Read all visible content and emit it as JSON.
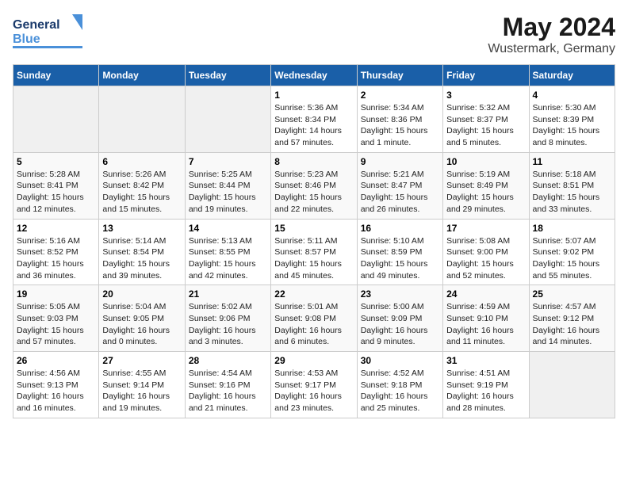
{
  "header": {
    "logo_general": "General",
    "logo_blue": "Blue",
    "title": "May 2024",
    "subtitle": "Wustermark, Germany"
  },
  "weekdays": [
    "Sunday",
    "Monday",
    "Tuesday",
    "Wednesday",
    "Thursday",
    "Friday",
    "Saturday"
  ],
  "weeks": [
    [
      {
        "day": "",
        "sunrise": "",
        "sunset": "",
        "daylight": ""
      },
      {
        "day": "",
        "sunrise": "",
        "sunset": "",
        "daylight": ""
      },
      {
        "day": "",
        "sunrise": "",
        "sunset": "",
        "daylight": ""
      },
      {
        "day": "1",
        "sunrise": "Sunrise: 5:36 AM",
        "sunset": "Sunset: 8:34 PM",
        "daylight": "Daylight: 14 hours and 57 minutes."
      },
      {
        "day": "2",
        "sunrise": "Sunrise: 5:34 AM",
        "sunset": "Sunset: 8:36 PM",
        "daylight": "Daylight: 15 hours and 1 minute."
      },
      {
        "day": "3",
        "sunrise": "Sunrise: 5:32 AM",
        "sunset": "Sunset: 8:37 PM",
        "daylight": "Daylight: 15 hours and 5 minutes."
      },
      {
        "day": "4",
        "sunrise": "Sunrise: 5:30 AM",
        "sunset": "Sunset: 8:39 PM",
        "daylight": "Daylight: 15 hours and 8 minutes."
      }
    ],
    [
      {
        "day": "5",
        "sunrise": "Sunrise: 5:28 AM",
        "sunset": "Sunset: 8:41 PM",
        "daylight": "Daylight: 15 hours and 12 minutes."
      },
      {
        "day": "6",
        "sunrise": "Sunrise: 5:26 AM",
        "sunset": "Sunset: 8:42 PM",
        "daylight": "Daylight: 15 hours and 15 minutes."
      },
      {
        "day": "7",
        "sunrise": "Sunrise: 5:25 AM",
        "sunset": "Sunset: 8:44 PM",
        "daylight": "Daylight: 15 hours and 19 minutes."
      },
      {
        "day": "8",
        "sunrise": "Sunrise: 5:23 AM",
        "sunset": "Sunset: 8:46 PM",
        "daylight": "Daylight: 15 hours and 22 minutes."
      },
      {
        "day": "9",
        "sunrise": "Sunrise: 5:21 AM",
        "sunset": "Sunset: 8:47 PM",
        "daylight": "Daylight: 15 hours and 26 minutes."
      },
      {
        "day": "10",
        "sunrise": "Sunrise: 5:19 AM",
        "sunset": "Sunset: 8:49 PM",
        "daylight": "Daylight: 15 hours and 29 minutes."
      },
      {
        "day": "11",
        "sunrise": "Sunrise: 5:18 AM",
        "sunset": "Sunset: 8:51 PM",
        "daylight": "Daylight: 15 hours and 33 minutes."
      }
    ],
    [
      {
        "day": "12",
        "sunrise": "Sunrise: 5:16 AM",
        "sunset": "Sunset: 8:52 PM",
        "daylight": "Daylight: 15 hours and 36 minutes."
      },
      {
        "day": "13",
        "sunrise": "Sunrise: 5:14 AM",
        "sunset": "Sunset: 8:54 PM",
        "daylight": "Daylight: 15 hours and 39 minutes."
      },
      {
        "day": "14",
        "sunrise": "Sunrise: 5:13 AM",
        "sunset": "Sunset: 8:55 PM",
        "daylight": "Daylight: 15 hours and 42 minutes."
      },
      {
        "day": "15",
        "sunrise": "Sunrise: 5:11 AM",
        "sunset": "Sunset: 8:57 PM",
        "daylight": "Daylight: 15 hours and 45 minutes."
      },
      {
        "day": "16",
        "sunrise": "Sunrise: 5:10 AM",
        "sunset": "Sunset: 8:59 PM",
        "daylight": "Daylight: 15 hours and 49 minutes."
      },
      {
        "day": "17",
        "sunrise": "Sunrise: 5:08 AM",
        "sunset": "Sunset: 9:00 PM",
        "daylight": "Daylight: 15 hours and 52 minutes."
      },
      {
        "day": "18",
        "sunrise": "Sunrise: 5:07 AM",
        "sunset": "Sunset: 9:02 PM",
        "daylight": "Daylight: 15 hours and 55 minutes."
      }
    ],
    [
      {
        "day": "19",
        "sunrise": "Sunrise: 5:05 AM",
        "sunset": "Sunset: 9:03 PM",
        "daylight": "Daylight: 15 hours and 57 minutes."
      },
      {
        "day": "20",
        "sunrise": "Sunrise: 5:04 AM",
        "sunset": "Sunset: 9:05 PM",
        "daylight": "Daylight: 16 hours and 0 minutes."
      },
      {
        "day": "21",
        "sunrise": "Sunrise: 5:02 AM",
        "sunset": "Sunset: 9:06 PM",
        "daylight": "Daylight: 16 hours and 3 minutes."
      },
      {
        "day": "22",
        "sunrise": "Sunrise: 5:01 AM",
        "sunset": "Sunset: 9:08 PM",
        "daylight": "Daylight: 16 hours and 6 minutes."
      },
      {
        "day": "23",
        "sunrise": "Sunrise: 5:00 AM",
        "sunset": "Sunset: 9:09 PM",
        "daylight": "Daylight: 16 hours and 9 minutes."
      },
      {
        "day": "24",
        "sunrise": "Sunrise: 4:59 AM",
        "sunset": "Sunset: 9:10 PM",
        "daylight": "Daylight: 16 hours and 11 minutes."
      },
      {
        "day": "25",
        "sunrise": "Sunrise: 4:57 AM",
        "sunset": "Sunset: 9:12 PM",
        "daylight": "Daylight: 16 hours and 14 minutes."
      }
    ],
    [
      {
        "day": "26",
        "sunrise": "Sunrise: 4:56 AM",
        "sunset": "Sunset: 9:13 PM",
        "daylight": "Daylight: 16 hours and 16 minutes."
      },
      {
        "day": "27",
        "sunrise": "Sunrise: 4:55 AM",
        "sunset": "Sunset: 9:14 PM",
        "daylight": "Daylight: 16 hours and 19 minutes."
      },
      {
        "day": "28",
        "sunrise": "Sunrise: 4:54 AM",
        "sunset": "Sunset: 9:16 PM",
        "daylight": "Daylight: 16 hours and 21 minutes."
      },
      {
        "day": "29",
        "sunrise": "Sunrise: 4:53 AM",
        "sunset": "Sunset: 9:17 PM",
        "daylight": "Daylight: 16 hours and 23 minutes."
      },
      {
        "day": "30",
        "sunrise": "Sunrise: 4:52 AM",
        "sunset": "Sunset: 9:18 PM",
        "daylight": "Daylight: 16 hours and 25 minutes."
      },
      {
        "day": "31",
        "sunrise": "Sunrise: 4:51 AM",
        "sunset": "Sunset: 9:19 PM",
        "daylight": "Daylight: 16 hours and 28 minutes."
      },
      {
        "day": "",
        "sunrise": "",
        "sunset": "",
        "daylight": ""
      }
    ]
  ]
}
